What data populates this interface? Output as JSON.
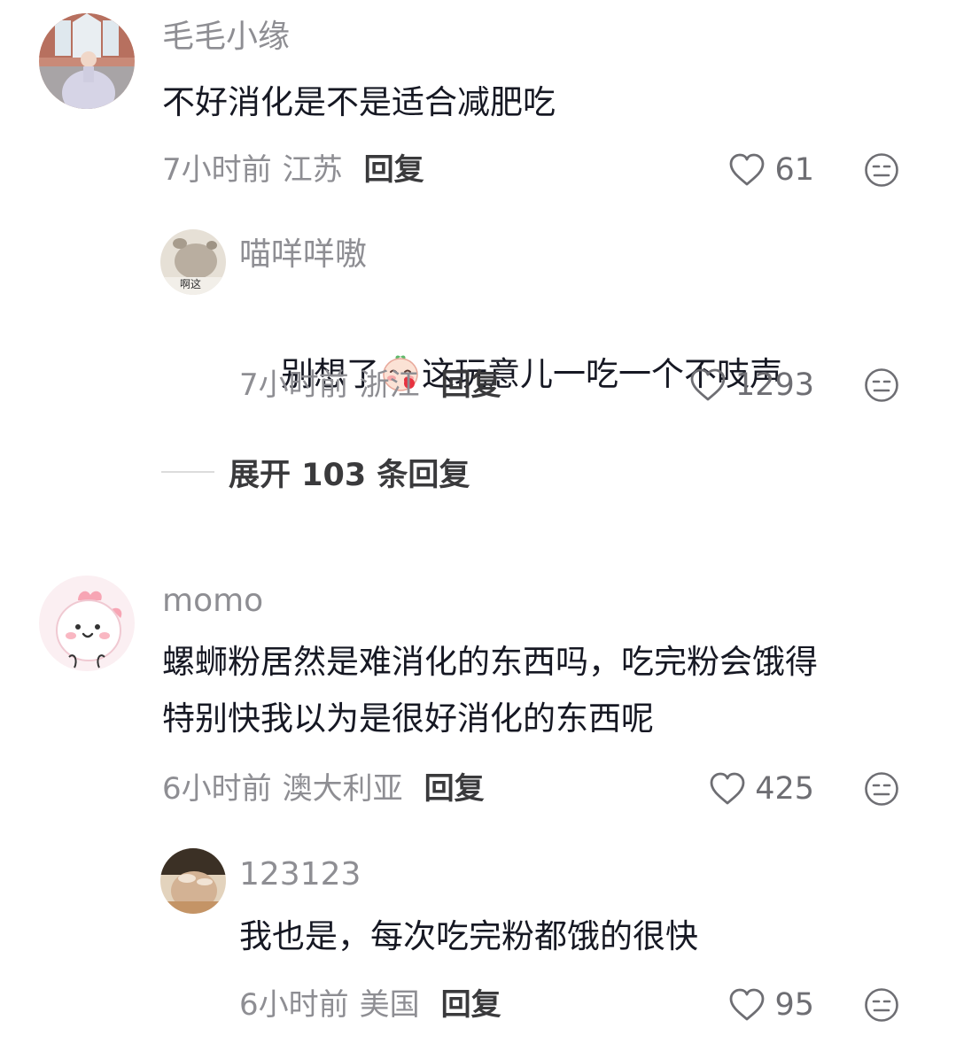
{
  "comments": [
    {
      "username": "毛毛小缘",
      "text": "不好消化是不是适合减肥吃",
      "time": "7小时前",
      "location": "江苏",
      "reply_label": "回复",
      "likes": "61"
    },
    {
      "username": "喵咩咩嗷",
      "text_before": "别想了",
      "text_after": "这玩意儿一吃一个不吱声",
      "time": "7小时前",
      "location": "浙江",
      "reply_label": "回复",
      "likes": "1293",
      "avatar_caption": "啊这"
    },
    {
      "username": "momo",
      "text": "螺蛳粉居然是难消化的东西吗，吃完粉会饿得\n特别快我以为是很好消化的东西呢",
      "time": "6小时前",
      "location": "澳大利亚",
      "reply_label": "回复",
      "likes": "425"
    },
    {
      "username": "123123",
      "text": "我也是，每次吃完粉都饿的很快",
      "time": "6小时前",
      "location": "美国",
      "reply_label": "回复",
      "likes": "95"
    }
  ],
  "expand_replies": "展开 103 条回复",
  "icons": {
    "like": "heart-outline-icon",
    "dislike": "neutral-face-icon",
    "inline_emoji": "blush-face-emoji"
  },
  "colors": {
    "username": "#8e8e93",
    "content": "#161823",
    "meta": "#8e8e93",
    "reply": "#3a3a3c"
  }
}
